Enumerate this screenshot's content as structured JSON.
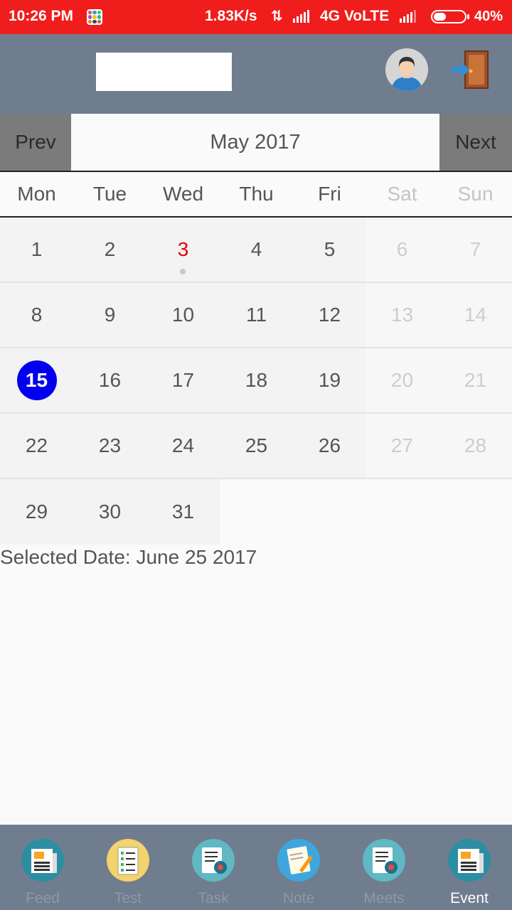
{
  "status_bar": {
    "time": "10:26 PM",
    "speed": "1.83K/s",
    "network": "4G VoLTE",
    "battery": "40%",
    "battery_level": 0.4
  },
  "header": {
    "avatar_icon": "user-avatar-icon",
    "logout_icon": "exit-door-icon"
  },
  "calendar": {
    "prev_label": "Prev",
    "next_label": "Next",
    "month_title": "May 2017",
    "weekdays": [
      "Mon",
      "Tue",
      "Wed",
      "Thu",
      "Fri",
      "Sat",
      "Sun"
    ],
    "weeks": [
      [
        "1",
        "2",
        "3",
        "4",
        "5",
        "6",
        "7"
      ],
      [
        "8",
        "9",
        "10",
        "11",
        "12",
        "13",
        "14"
      ],
      [
        "15",
        "16",
        "17",
        "18",
        "19",
        "20",
        "21"
      ],
      [
        "22",
        "23",
        "24",
        "25",
        "26",
        "27",
        "28"
      ],
      [
        "29",
        "30",
        "31",
        "",
        "",
        "",
        ""
      ]
    ],
    "today": "3",
    "selected": "15",
    "event_dot_day": "3"
  },
  "selected_date_text": "Selected Date: June 25 2017",
  "bottom_nav": {
    "tabs": [
      {
        "label": "Feed",
        "icon": "newspaper-icon"
      },
      {
        "label": "Test",
        "icon": "checklist-icon"
      },
      {
        "label": "Task",
        "icon": "task-gear-icon"
      },
      {
        "label": "Note",
        "icon": "notepad-pen-icon"
      },
      {
        "label": "Meets",
        "icon": "meeting-gear-icon"
      },
      {
        "label": "Event",
        "icon": "newspaper-icon"
      }
    ],
    "active": "Event"
  },
  "colors": {
    "status_bar": "#f01d1d",
    "header": "#707d8e",
    "selected_day": "#0000ee",
    "today": "#e60000"
  }
}
